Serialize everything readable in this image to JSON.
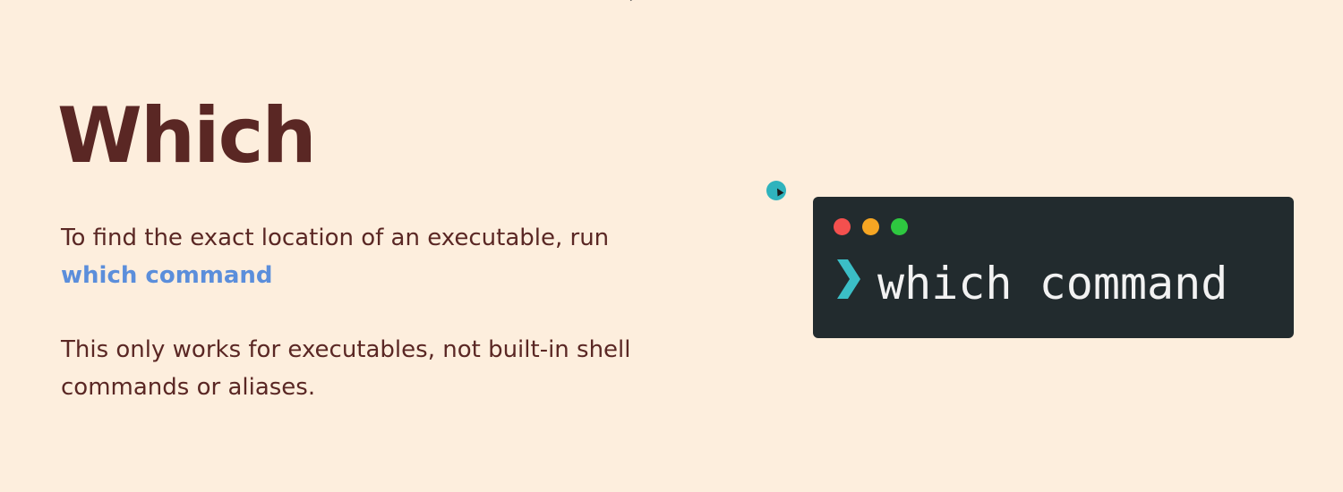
{
  "slide": {
    "title": "Which",
    "paragraph1": {
      "text_before": "To find the exact location of an executable, run ",
      "highlight": "which command"
    },
    "paragraph2": "This only works for executables, not built-in shell commands or aliases."
  },
  "terminal": {
    "command": "which command",
    "prompt_icon": "chevron-right-icon"
  },
  "colors": {
    "background": "#FDEEDD",
    "title": "#5A2724",
    "body_text": "#5A2724",
    "highlight": "#5B8EDB",
    "terminal_bg": "#222B2E",
    "prompt": "#3BBEC6",
    "dot_red": "#F4504E",
    "dot_yellow": "#F6A623",
    "dot_green": "#2EC840",
    "cursor_highlight": "#2FB3BD"
  }
}
